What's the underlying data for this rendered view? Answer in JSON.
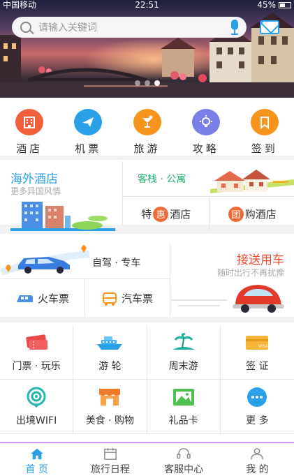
{
  "status_bar": {
    "carrier": "中国移动",
    "time": "22:51",
    "battery": "45%"
  },
  "search": {
    "placeholder": "请输入关键词"
  },
  "banner": {
    "pages": 3,
    "active_page": 3
  },
  "quick_nav": [
    {
      "label": "酒店",
      "icon": "hotel-icon",
      "color": "#f0603a"
    },
    {
      "label": "机票",
      "icon": "plane-icon",
      "color": "#2aa0e8"
    },
    {
      "label": "旅游",
      "icon": "cocktail-icon",
      "color": "#f7941d"
    },
    {
      "label": "攻略",
      "icon": "bulb-icon",
      "color": "#7b7fe8"
    },
    {
      "label": "签到",
      "icon": "bookmark-icon",
      "color": "#f7941d"
    }
  ],
  "hotel": {
    "overseas_title": "海外酒店",
    "overseas_subtitle": "更多异国风情",
    "inn_title": "客栈 · 公寓",
    "special_prefix": "特",
    "special_badge": "惠",
    "special_suffix": "酒店",
    "group_badge": "团",
    "group_label": "购酒店"
  },
  "transport": {
    "drive_label": "自驾 · 专车",
    "train_label": "火车票",
    "bus_label": "汽车票",
    "pickup_title": "接送用车",
    "pickup_subtitle": "随时出行不再扰豫"
  },
  "services": [
    {
      "label": "门票 · 玩乐",
      "icon": "ticket-icon"
    },
    {
      "label": "游 轮",
      "icon": "cruise-ship-icon"
    },
    {
      "label": "周末游",
      "icon": "island-icon"
    },
    {
      "label": "签 证",
      "icon": "visa-card-icon"
    },
    {
      "label": "出境WIFI",
      "icon": "wifi-icon"
    },
    {
      "label": "美食 · 购物",
      "icon": "shop-icon"
    },
    {
      "label": "礼品卡",
      "icon": "gift-card-icon"
    },
    {
      "label": "更 多",
      "icon": "more-icon"
    }
  ],
  "tabs": [
    {
      "label": "首 页",
      "icon": "home-icon",
      "active": true
    },
    {
      "label": "旅行日程",
      "icon": "calendar-icon",
      "active": false
    },
    {
      "label": "客服中心",
      "icon": "headset-icon",
      "active": false
    },
    {
      "label": "我 的",
      "icon": "user-icon",
      "active": false
    }
  ],
  "colors": {
    "accent": "#2aa0e8",
    "green": "#1fb06b",
    "orange": "#f06a35",
    "red": "#ec4a2f"
  }
}
